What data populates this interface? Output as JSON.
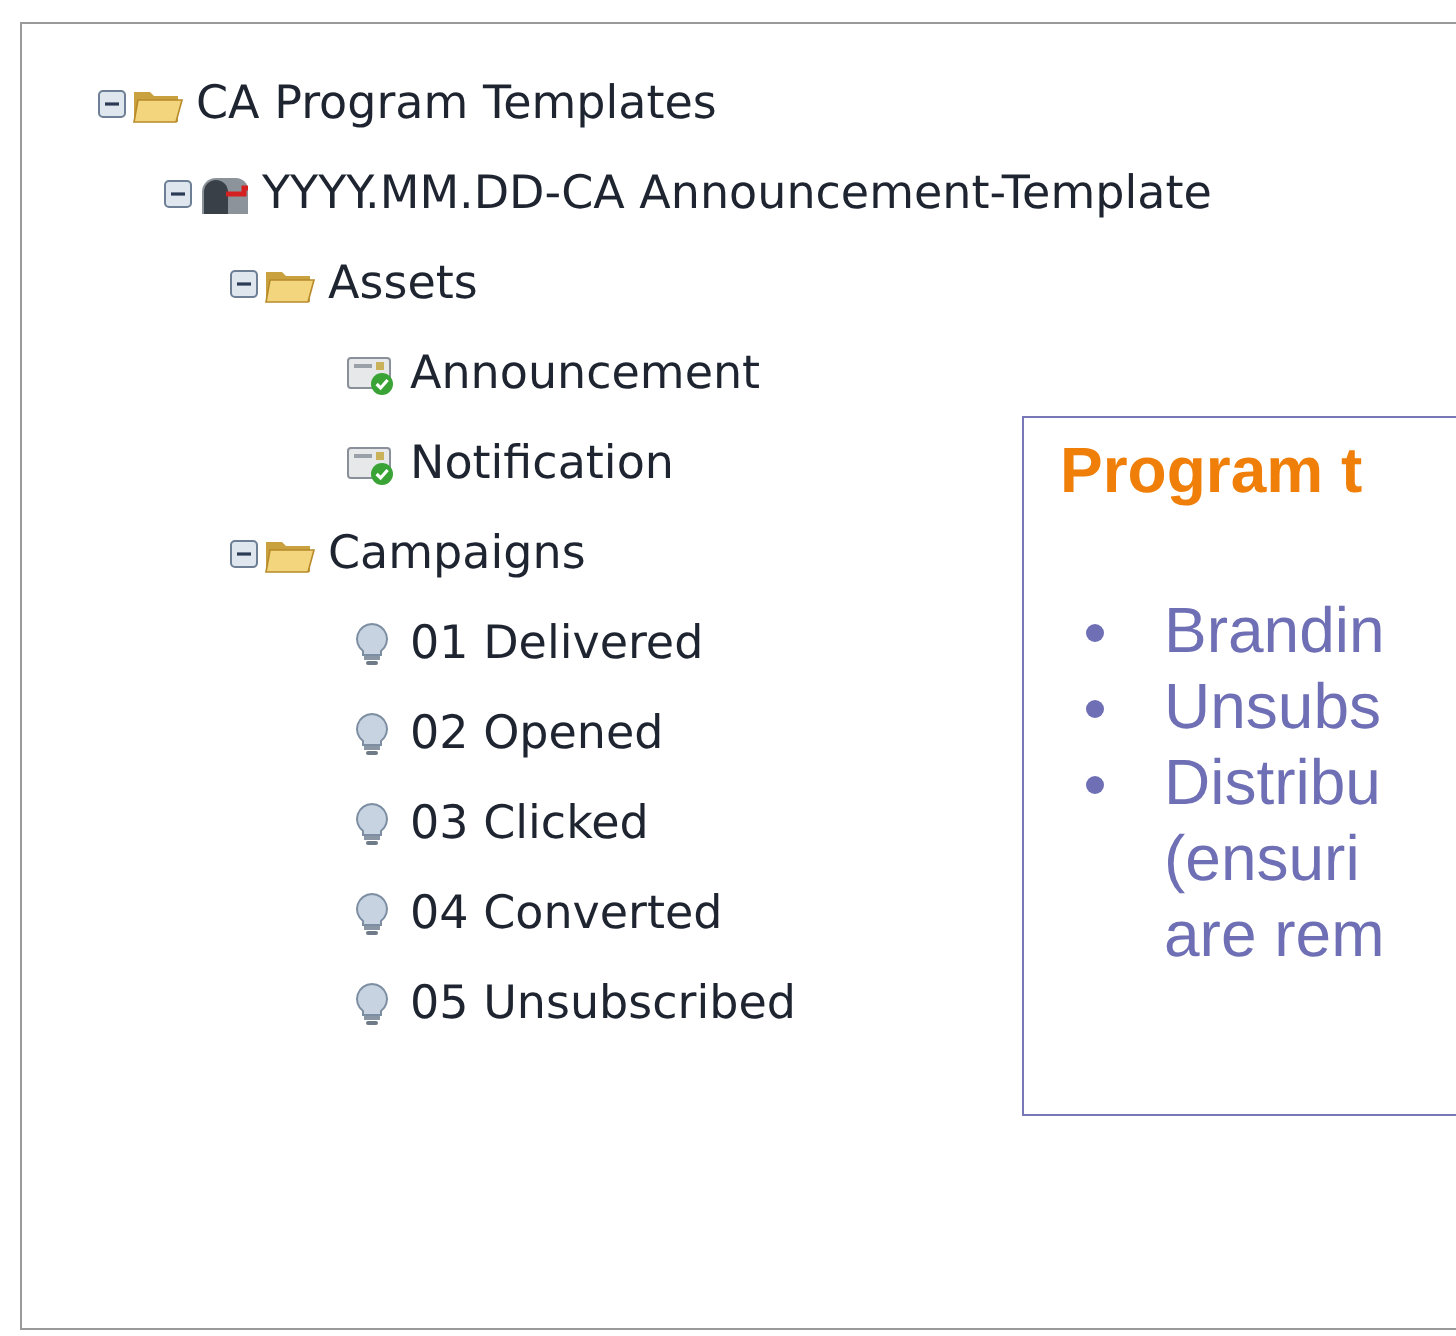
{
  "tree": [
    {
      "label": "CA Program Templates",
      "kind": "folder",
      "expanded": true,
      "children": [
        {
          "label": "YYYY.MM.DD-CA Announcement-Template",
          "kind": "program",
          "expanded": true,
          "children": [
            {
              "label": "Assets",
              "kind": "folder",
              "expanded": true,
              "children": [
                {
                  "label": "Announcement",
                  "kind": "email"
                },
                {
                  "label": "Notification",
                  "kind": "email"
                }
              ]
            },
            {
              "label": "Campaigns",
              "kind": "folder",
              "expanded": true,
              "children": [
                {
                  "label": "01 Delivered",
                  "kind": "campaign"
                },
                {
                  "label": "02 Opened",
                  "kind": "campaign"
                },
                {
                  "label": "03 Clicked",
                  "kind": "campaign"
                },
                {
                  "label": "04 Converted",
                  "kind": "campaign"
                },
                {
                  "label": "05 Unsubscribed",
                  "kind": "campaign"
                }
              ]
            }
          ]
        }
      ]
    }
  ],
  "callout": {
    "title": "Program t",
    "bullets": [
      {
        "lines": [
          "Brandin"
        ]
      },
      {
        "lines": [
          "Unsubs"
        ]
      },
      {
        "lines": [
          "Distribu",
          "(ensuri",
          "are rem"
        ]
      }
    ]
  }
}
